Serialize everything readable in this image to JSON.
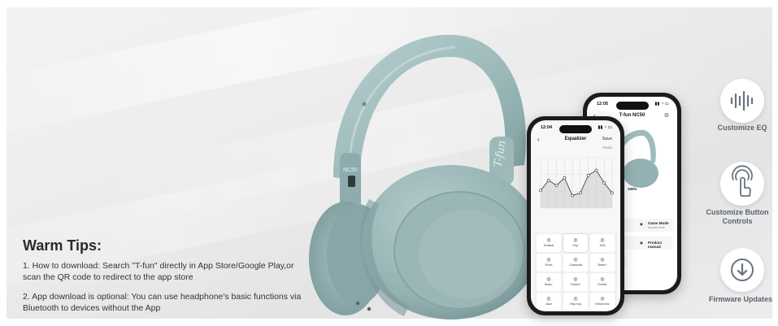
{
  "tips": {
    "title": "Warm Tips:",
    "item1": "1. How to download: Search \"T-fun\" directly in App Store/Google Play,or scan the QR code to redirect to the app store",
    "item2": "2. App download is optional: You can use headphone's basic functions via Bluetooth to devices without the App"
  },
  "headphone": {
    "brand_mark": "T-fun",
    "model_mark": "NC50",
    "color": "#9fbcbd"
  },
  "phone_back": {
    "time": "12:05",
    "title": "T-fun NC50",
    "battery": "100%",
    "rows": [
      "Game Mode",
      "Product manual"
    ],
    "game_mode_sub": "Normal mode"
  },
  "phone_front": {
    "time": "12:04",
    "title": "Equalizer",
    "save": "Save",
    "reset": "Reset",
    "eq_levels": [
      0.35,
      0.55,
      0.45,
      0.6,
      0.25,
      0.3,
      0.65,
      0.75,
      0.5,
      0.3
    ],
    "presets": [
      "Default",
      "Pop",
      "Soft",
      "Rock",
      "Classical",
      "Bass+",
      "Bass-",
      "Treble+",
      "Treble-",
      "Jazz",
      "Hip-hop",
      "Electronic"
    ],
    "selected_preset": "Pop"
  },
  "features": [
    {
      "label": "Customize EQ",
      "icon": "soundwave-icon"
    },
    {
      "label": "Customize Button Controls",
      "icon": "touch-icon"
    },
    {
      "label": "Firmware Updates",
      "icon": "download-icon"
    }
  ],
  "colors": {
    "background": "#ececec",
    "headphone": "#9fbcbd",
    "feature_text": "#5b6270",
    "phone_frame": "#1b1b1f"
  }
}
